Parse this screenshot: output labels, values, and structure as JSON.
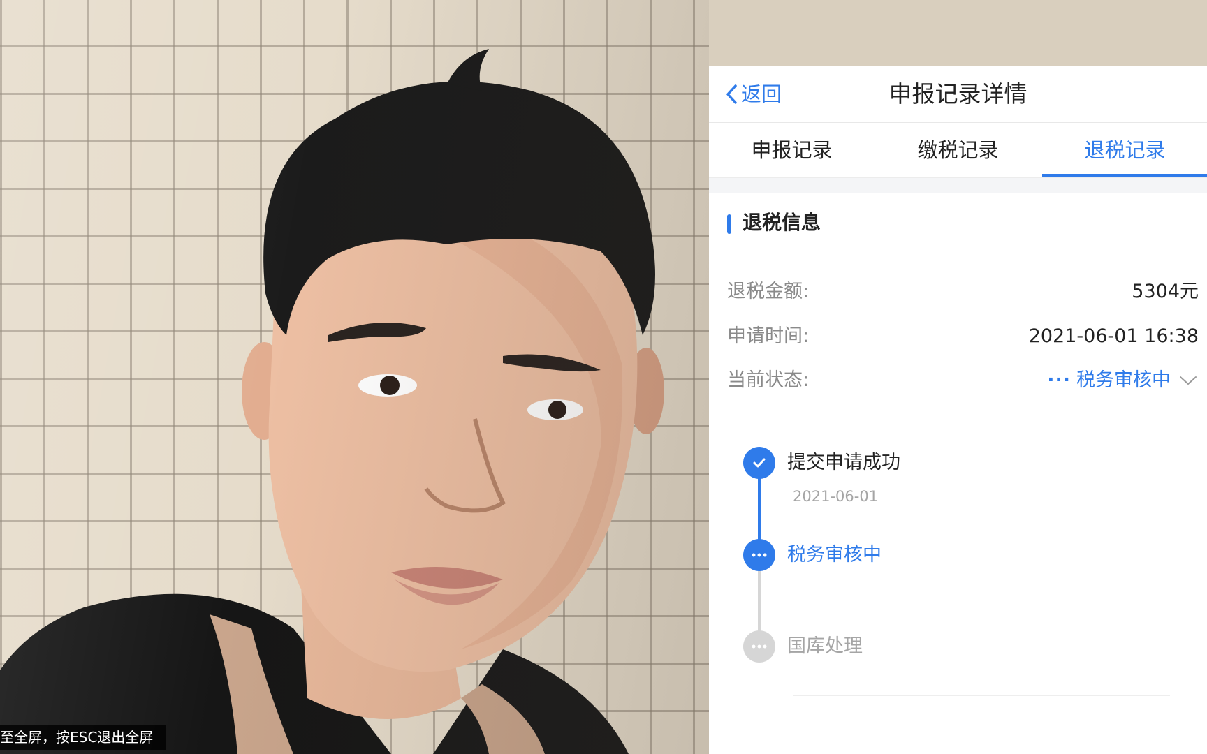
{
  "player": {
    "fullscreen_hint": "至全屏，按ESC退出全屏"
  },
  "app": {
    "back_label": "返回",
    "title": "申报记录详情",
    "tabs": [
      {
        "label": "申报记录",
        "active": false
      },
      {
        "label": "缴税记录",
        "active": false
      },
      {
        "label": "退税记录",
        "active": true
      }
    ],
    "section_title": "退税信息",
    "fields": {
      "amount_label": "退税金额:",
      "amount_value": "5304元",
      "time_label": "申请时间:",
      "time_value": "2021-06-01 16:38",
      "status_label": "当前状态:",
      "status_dots": "···",
      "status_value": "税务审核中"
    },
    "timeline": [
      {
        "label": "提交申请成功",
        "date": "2021-06-01",
        "state": "done"
      },
      {
        "label": "税务审核中",
        "date": "",
        "state": "current"
      },
      {
        "label": "国库处理",
        "date": "",
        "state": "pending"
      }
    ],
    "colors": {
      "accent": "#2f7bea",
      "pending": "#d6d6d6",
      "muted_text": "#a5a5a5"
    },
    "icons": [
      "chevron-left-icon",
      "check-icon",
      "ellipsis-icon",
      "chevron-down-icon"
    ]
  }
}
